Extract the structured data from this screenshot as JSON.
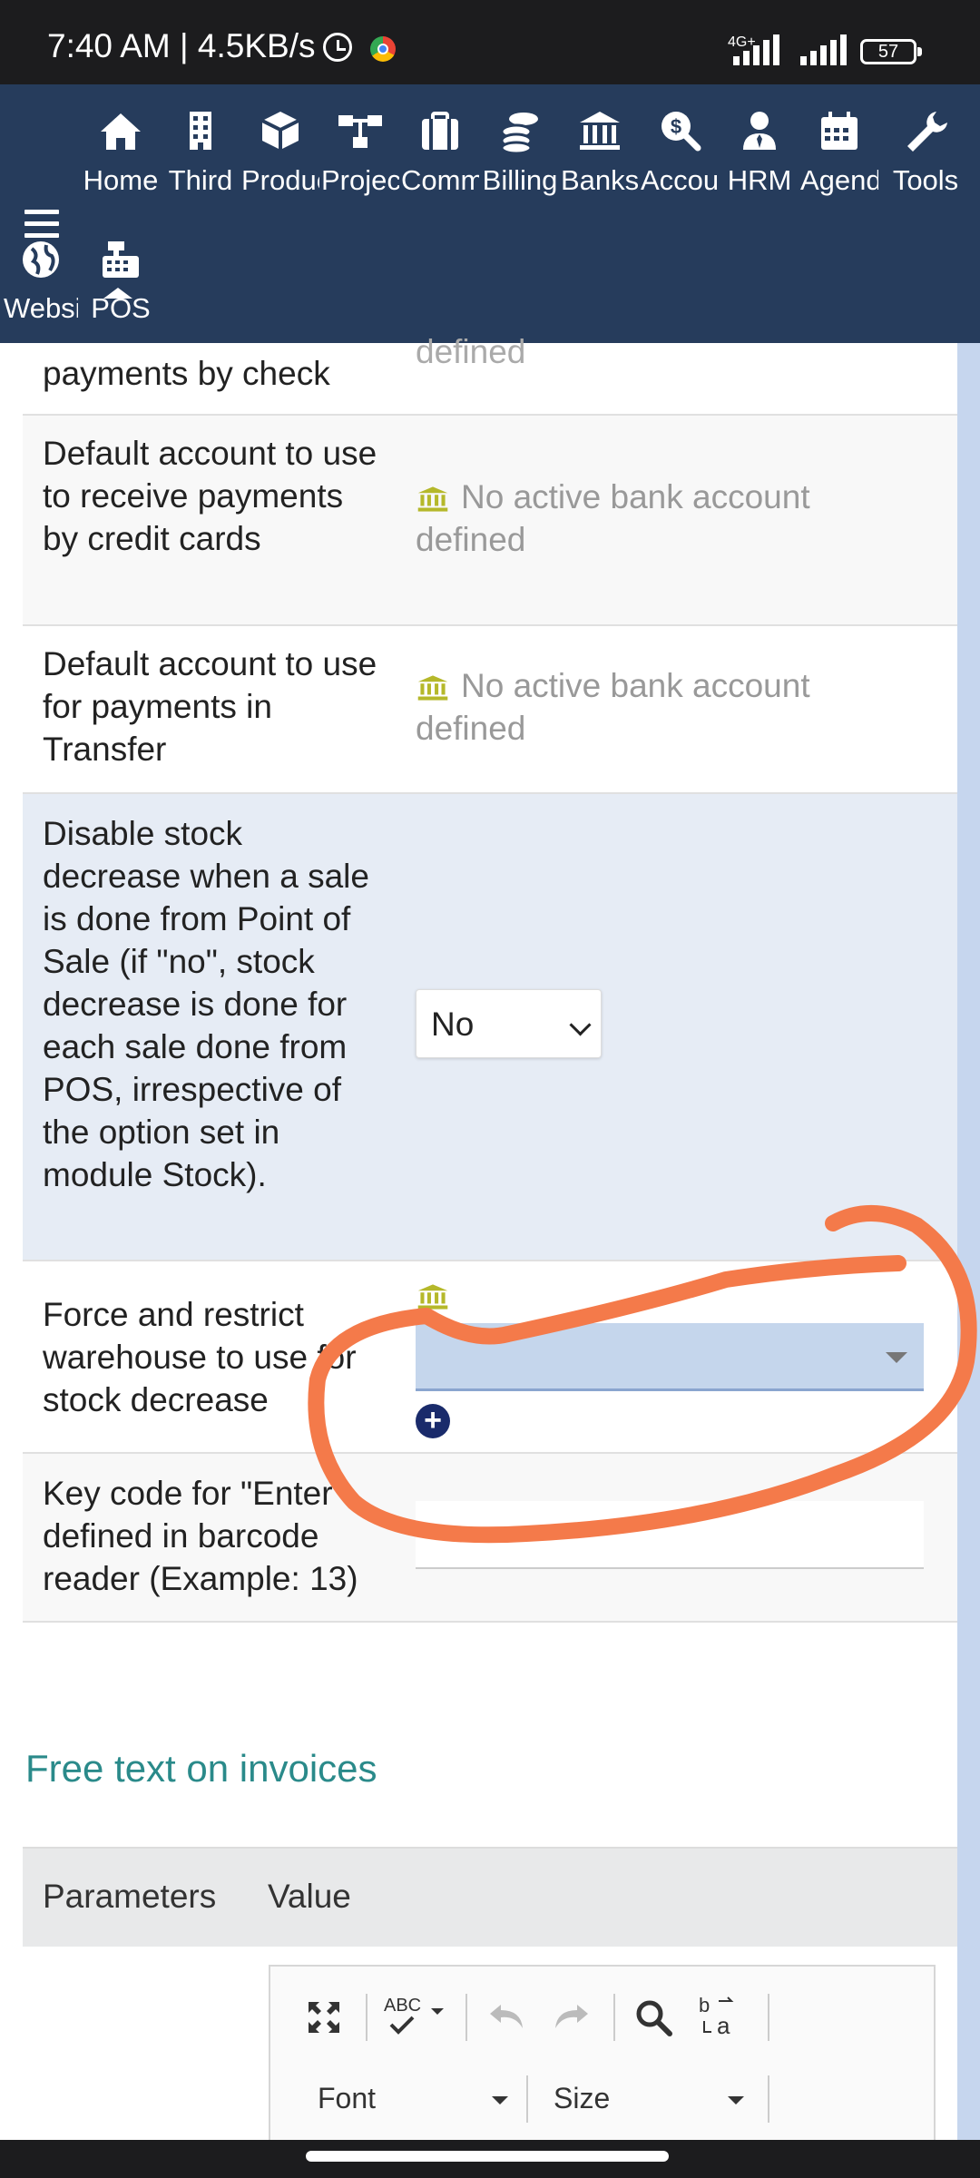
{
  "status_bar": {
    "time": "7:40 AM | 4.5KB/s",
    "network_type": "4G+",
    "battery": "57"
  },
  "top_nav": {
    "items": [
      {
        "label": "Home",
        "icon": "home-icon"
      },
      {
        "label": "Third",
        "icon": "building-icon"
      },
      {
        "label": "Products",
        "icon": "cube-icon"
      },
      {
        "label": "Projects",
        "icon": "sitemap-icon"
      },
      {
        "label": "Commercial",
        "icon": "briefcase-icon"
      },
      {
        "label": "Billing",
        "icon": "coins-icon"
      },
      {
        "label": "Banks",
        "icon": "bank-icon"
      },
      {
        "label": "Accounting",
        "icon": "search-dollar-icon"
      },
      {
        "label": "HRM",
        "icon": "user-tie-icon"
      },
      {
        "label": "Agenda",
        "icon": "calendar-icon"
      },
      {
        "label": "Tools",
        "icon": "wrench-icon"
      }
    ],
    "second_row": [
      {
        "label": "Website",
        "icon": "globe-icon"
      },
      {
        "label": "POS",
        "icon": "cash-register-icon"
      }
    ],
    "active": "Home"
  },
  "settings": {
    "row0": {
      "label": "payments by check",
      "value": "defined"
    },
    "row1": {
      "label": "Default account to use to receive payments by credit cards",
      "value_line1": "No active bank account",
      "value_line2": "defined"
    },
    "row2": {
      "label": "Default account to use for payments in Transfer",
      "value_line1": "No active bank account",
      "value_line2": "defined"
    },
    "row3": {
      "label": "Disable stock decrease when a sale is done from Point of Sale (if \"no\", stock decrease is done for each sale done from POS, irrespective of the option set in module Stock).",
      "value": "No"
    },
    "row4": {
      "label": "Force and restrict warehouse to use for stock decrease",
      "value": ""
    },
    "row5": {
      "label": "Key code for \"Enter\" defined in barcode reader (Example: 13)",
      "value": ""
    }
  },
  "free_text_section": {
    "title": "Free text on invoices",
    "col_parameters": "Parameters",
    "col_value": "Value"
  },
  "editor_toolbar": {
    "font_label": "Font",
    "size_label": "Size",
    "spell_label": "ABC"
  },
  "colors": {
    "nav_bg": "#263c5c",
    "annotation": "#f47a4a",
    "section_title": "#2a8a8a",
    "bank_icon": "#b5b82a"
  }
}
